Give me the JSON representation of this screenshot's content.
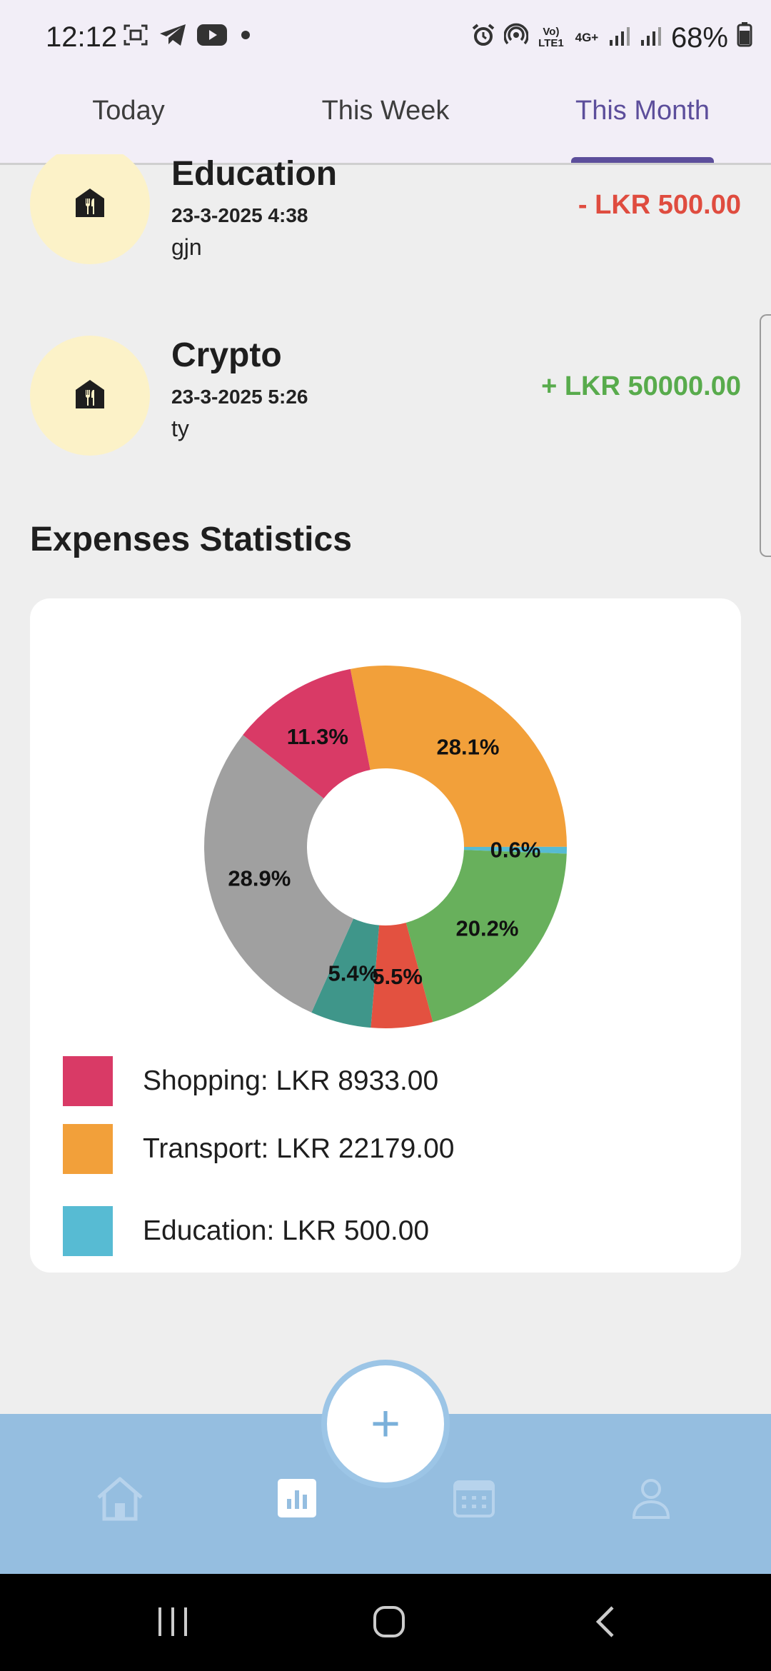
{
  "status_bar": {
    "time": "12:12",
    "battery": "68%",
    "icons": [
      "screenshot-icon",
      "telegram-icon",
      "youtube-icon",
      "dot-icon",
      "alarm-icon",
      "hotspot-icon",
      "volte-icon",
      "network-4g-icon",
      "signal-icon",
      "signal-icon",
      "battery-icon"
    ],
    "volte_label": "Vo) LTE1",
    "net_label": "4G+"
  },
  "tabs": [
    {
      "label": "Today",
      "active": false
    },
    {
      "label": "This Week",
      "active": false
    },
    {
      "label": "This Month",
      "active": true
    }
  ],
  "transactions": [
    {
      "title": "Education",
      "date": "23-3-2025 4:38",
      "note": "gjn",
      "amount": "- LKR 500.00",
      "type": "expense",
      "icon": "restaurant-icon"
    },
    {
      "title": "Crypto",
      "date": "23-3-2025 5:26",
      "note": "ty",
      "amount": "+ LKR 50000.00",
      "type": "income",
      "icon": "restaurant-icon"
    }
  ],
  "section_title": "Expenses Statistics",
  "chart_data": {
    "type": "pie",
    "donut": true,
    "start_angle": "top",
    "slices": [
      {
        "label": "28.1%",
        "value": 28.1,
        "color": "#f2a03a"
      },
      {
        "label": "0.6%",
        "value": 0.6,
        "color": "#57bbd3"
      },
      {
        "label": "20.2%",
        "value": 20.2,
        "color": "#68b05c"
      },
      {
        "label": "5.5%",
        "value": 5.5,
        "color": "#e35140"
      },
      {
        "label": "5.4%",
        "value": 5.4,
        "color": "#3f968a"
      },
      {
        "label": "28.9%",
        "value": 28.9,
        "color": "#a0a0a0"
      },
      {
        "label": "11.3%",
        "value": 11.3,
        "color": "#d93a66"
      }
    ],
    "legend": [
      {
        "label": "Shopping: LKR 8933.00",
        "color": "#d93a66"
      },
      {
        "label": "Transport: LKR 22179.00",
        "color": "#f2a03a"
      },
      {
        "label": "Education: LKR 500.00",
        "color": "#57bbd3"
      }
    ]
  },
  "fab": {
    "label": "+"
  },
  "bottom_nav": [
    {
      "icon": "home-icon",
      "active": false
    },
    {
      "icon": "stats-icon",
      "active": true
    },
    {
      "icon": "calendar-icon",
      "active": false
    },
    {
      "icon": "profile-icon",
      "active": false
    }
  ],
  "system_nav": [
    "recents-icon",
    "home-circle-icon",
    "back-icon"
  ]
}
